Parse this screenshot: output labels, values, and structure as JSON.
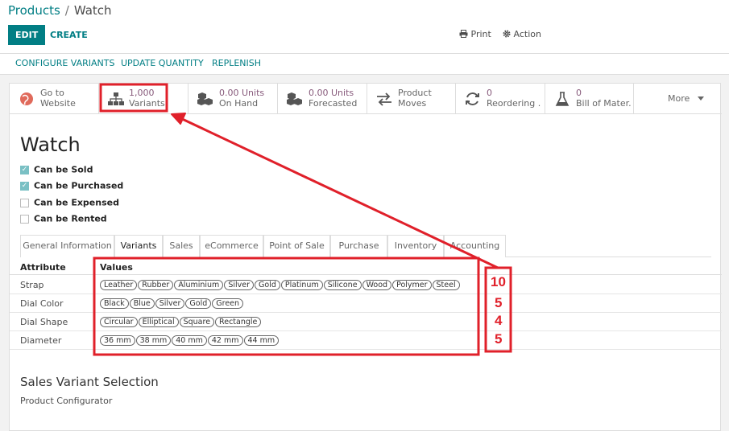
{
  "breadcrumb": {
    "parent": "Products",
    "separator": "/",
    "current": "Watch"
  },
  "toolbar": {
    "edit_label": "EDIT",
    "create_label": "CREATE",
    "print_label": "Print",
    "action_label": "Action"
  },
  "header_buttons": [
    "CONFIGURE VARIANTS",
    "UPDATE QUANTITY",
    "REPLENISH"
  ],
  "smart_buttons": [
    {
      "value": "Go to",
      "label": "Website",
      "icon": "globe-icon"
    },
    {
      "value": "1,000",
      "label": "Variants",
      "icon": "sitemap-icon"
    },
    {
      "value": "0.00 Units",
      "label": "On Hand",
      "icon": "cubes-icon"
    },
    {
      "value": "0.00 Units",
      "label": "Forecasted",
      "icon": "cubes-icon"
    },
    {
      "value": "Product",
      "label": "Moves",
      "icon": "exchange-icon"
    },
    {
      "value": "0",
      "label": "Reordering ...",
      "icon": "refresh-icon"
    },
    {
      "value": "0",
      "label": "Bill of Mater...",
      "icon": "flask-icon"
    }
  ],
  "more_label": "More",
  "product_name": "Watch",
  "checkboxes": [
    {
      "label": "Can be Sold",
      "checked": true
    },
    {
      "label": "Can be Purchased",
      "checked": true
    },
    {
      "label": "Can be Expensed",
      "checked": false
    },
    {
      "label": "Can be Rented",
      "checked": false
    }
  ],
  "tabs": [
    "General Information",
    "Variants",
    "Sales",
    "eCommerce",
    "Point of Sale",
    "Purchase",
    "Inventory",
    "Accounting"
  ],
  "active_tab": "Variants",
  "attributes_table": {
    "headers": [
      "Attribute",
      "Values"
    ],
    "rows": [
      {
        "name": "Strap",
        "values": [
          "Leather",
          "Rubber",
          "Aluminium",
          "Silver",
          "Gold",
          "Platinum",
          "Silicone",
          "Wood",
          "Polymer",
          "Steel"
        ]
      },
      {
        "name": "Dial Color",
        "values": [
          "Black",
          "Blue",
          "Silver",
          "Gold",
          "Green"
        ]
      },
      {
        "name": "Dial Shape",
        "values": [
          "Circular",
          "Elliptical",
          "Square",
          "Rectangle"
        ]
      },
      {
        "name": "Diameter",
        "values": [
          "36 mm",
          "38 mm",
          "40 mm",
          "42 mm",
          "44 mm"
        ]
      }
    ]
  },
  "annotation_counts": [
    "10",
    "5",
    "4",
    "5"
  ],
  "sales_variant_section": {
    "title": "Sales Variant Selection",
    "value": "Product Configurator"
  },
  "colors": {
    "primary": "#017e84",
    "smart_value": "#875a7b",
    "annotation": "#e0202a"
  }
}
